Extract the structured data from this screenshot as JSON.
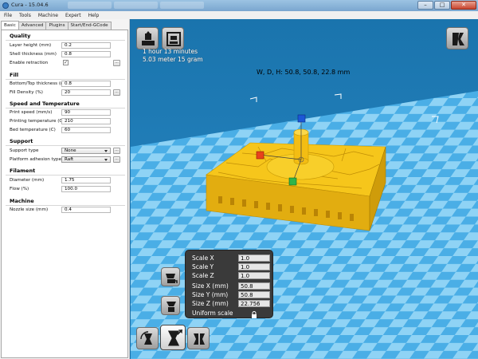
{
  "window": {
    "title": "Cura - 15.04.6"
  },
  "menubar": {
    "items": [
      "File",
      "Tools",
      "Machine",
      "Expert",
      "Help"
    ]
  },
  "tabs": [
    "Basic",
    "Advanced",
    "Plugins",
    "Start/End-GCode"
  ],
  "sections": {
    "quality": "Quality",
    "fill": "Fill",
    "speed": "Speed and Temperature",
    "support": "Support",
    "filament": "Filament",
    "machine": "Machine"
  },
  "fields": {
    "layer_height": {
      "label": "Layer height (mm)",
      "value": "0.2"
    },
    "shell_thickness": {
      "label": "Shell thickness (mm)",
      "value": "0.8"
    },
    "enable_retraction": {
      "label": "Enable retraction",
      "checked": "✓"
    },
    "bottom_top_thickness": {
      "label": "Bottom/Top thickness (mm)",
      "value": "0.8"
    },
    "fill_density": {
      "label": "Fill Density (%)",
      "value": "20"
    },
    "print_speed": {
      "label": "Print speed (mm/s)",
      "value": "90"
    },
    "printing_temp": {
      "label": "Printing temperature (C)",
      "value": "210"
    },
    "bed_temp": {
      "label": "Bed temperature (C)",
      "value": "60"
    },
    "support_type": {
      "label": "Support type",
      "value": "None"
    },
    "platform_adhesion": {
      "label": "Platform adhesion type",
      "value": "Raft"
    },
    "diameter": {
      "label": "Diameter (mm)",
      "value": "1.75"
    },
    "flow": {
      "label": "Flow (%)",
      "value": "100.0"
    },
    "nozzle_size": {
      "label": "Nozzle size (mm)",
      "value": "0.4"
    }
  },
  "buttons": {
    "more": "..."
  },
  "viewport": {
    "print_time": "1 hour 13 minutes",
    "usage": "5.03 meter 15 gram",
    "dimensions": "W, D, H: 50.8, 50.8, 22.8 mm"
  },
  "scale_panel": {
    "scale_x_label": "Scale X",
    "scale_x": "1.0",
    "scale_y_label": "Scale Y",
    "scale_y": "1.0",
    "scale_z_label": "Scale Z",
    "scale_z": "1.0",
    "size_x_label": "Size X (mm)",
    "size_x": "50.8",
    "size_y_label": "Size Y (mm)",
    "size_y": "50.8",
    "size_z_label": "Size Z (mm)",
    "size_z": "22.756",
    "uniform_label": "Uniform scale"
  },
  "colors": {
    "model": "#f5c518",
    "bed_light": "#8fd3f5",
    "bed_dark": "#4aaee6",
    "panel_bg": "#f4f4f4"
  }
}
